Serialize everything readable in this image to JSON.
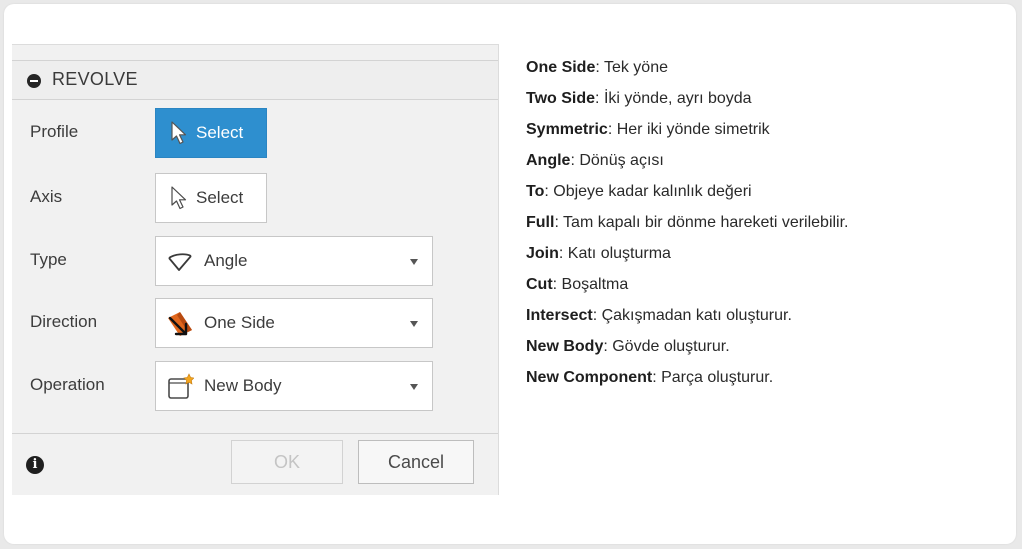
{
  "dialog": {
    "title": "REVOLVE",
    "rows": [
      {
        "label": "Profile",
        "control": "select",
        "value": "Select",
        "active": true
      },
      {
        "label": "Axis",
        "control": "select",
        "value": "Select",
        "active": false
      },
      {
        "label": "Type",
        "control": "dropdown",
        "value": "Angle",
        "icon": "angle-icon"
      },
      {
        "label": "Direction",
        "control": "dropdown",
        "value": "One Side",
        "icon": "direction-icon"
      },
      {
        "label": "Operation",
        "control": "dropdown",
        "value": "New Body",
        "icon": "new-body-icon"
      }
    ],
    "footer": {
      "ok_label": "OK",
      "cancel_label": "Cancel"
    }
  },
  "legend": [
    {
      "term": "One Side",
      "desc": ": Tek yöne"
    },
    {
      "term": "Two Side",
      "desc": ": İki yönde, ayrı boyda"
    },
    {
      "term": "Symmetric",
      "desc": ": Her iki yönde simetrik"
    },
    {
      "term": "Angle",
      "desc": ": Dönüş açısı"
    },
    {
      "term": "To",
      "desc": ": Objeye kadar kalınlık değeri"
    },
    {
      "term": "Full",
      "desc": ": Tam kapalı bir dönme hareketi verilebilir."
    },
    {
      "term": "Join",
      "desc": ": Katı oluşturma"
    },
    {
      "term": "Cut",
      "desc": ": Boşaltma"
    },
    {
      "term": "Intersect",
      "desc": ": Çakışmadan katı oluşturur."
    },
    {
      "term": "New Body",
      "desc": ": Gövde oluşturur."
    },
    {
      "term": "New Component",
      "desc": ": Parça oluşturur."
    }
  ],
  "colors": {
    "active_select": "#2e8fcf",
    "dialog_bg": "#f1f1f1",
    "page_bg": "#e9e9e9"
  }
}
